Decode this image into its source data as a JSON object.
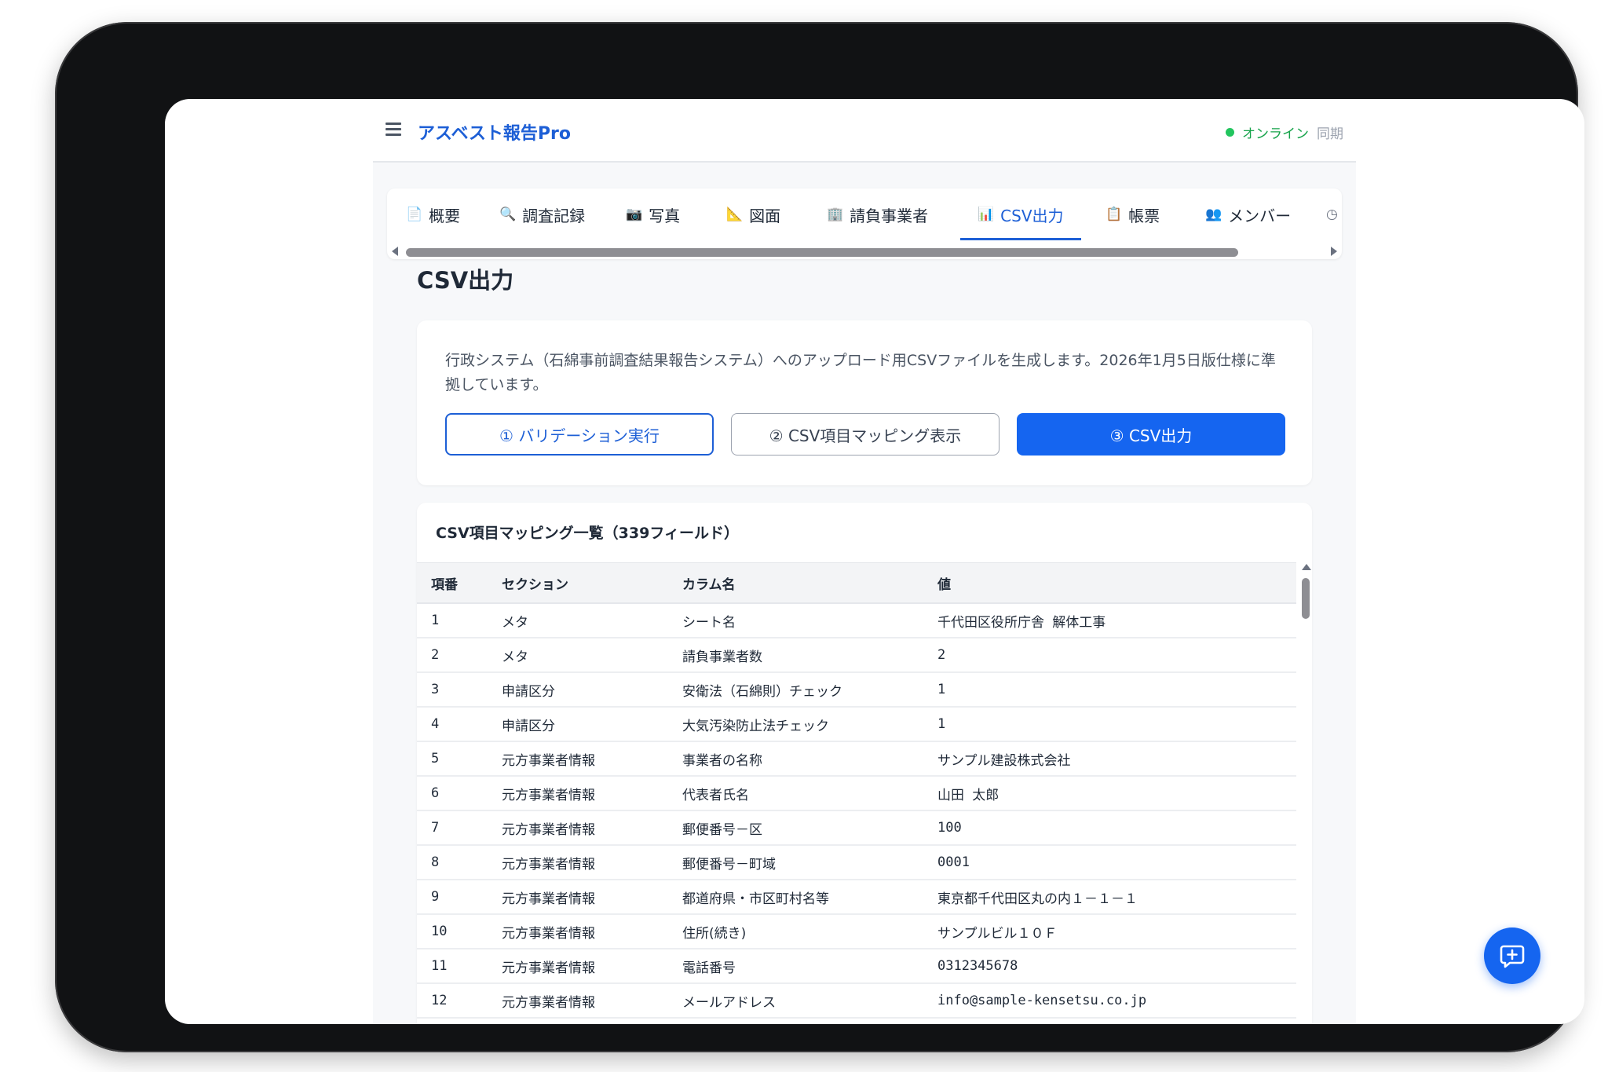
{
  "header": {
    "app_title": "アスベスト報告Pro",
    "status_label": "オンライン",
    "sync_label": "同期"
  },
  "tabs": [
    {
      "icon": "📄",
      "label": "概要"
    },
    {
      "icon": "🔍",
      "label": "調査記録"
    },
    {
      "icon": "📷",
      "label": "写真"
    },
    {
      "icon": "📐",
      "label": "図面"
    },
    {
      "icon": "🏢",
      "label": "請負事業者"
    },
    {
      "icon": "📊",
      "label": "CSV出力"
    },
    {
      "icon": "📋",
      "label": "帳票"
    },
    {
      "icon": "👥",
      "label": "メンバー"
    }
  ],
  "page": {
    "title": "CSV出力"
  },
  "info": {
    "description": "行政システム（石綿事前調査結果報告システム）へのアップロード用CSVファイルを生成します。2026年1月5日版仕様に準拠しています。",
    "validate_button": "① バリデーション実行",
    "mapping_button": "② CSV項目マッピング表示",
    "export_button": "③ CSV出力"
  },
  "mapping_table": {
    "title": "CSV項目マッピング一覧（339フィールド）",
    "columns": [
      "項番",
      "セクション",
      "カラム名",
      "値"
    ],
    "rows": [
      [
        "1",
        "メタ",
        "シート名",
        "千代田区役所庁舎 解体工事"
      ],
      [
        "2",
        "メタ",
        "請負事業者数",
        "2"
      ],
      [
        "3",
        "申請区分",
        "安衛法（石綿則）チェック",
        "1"
      ],
      [
        "4",
        "申請区分",
        "大気汚染防止法チェック",
        "1"
      ],
      [
        "5",
        "元方事業者情報",
        "事業者の名称",
        "サンプル建設株式会社"
      ],
      [
        "6",
        "元方事業者情報",
        "代表者氏名",
        "山田 太郎"
      ],
      [
        "7",
        "元方事業者情報",
        "郵便番号－区",
        "100"
      ],
      [
        "8",
        "元方事業者情報",
        "郵便番号－町域",
        "0001"
      ],
      [
        "9",
        "元方事業者情報",
        "都道府県・市区町村名等",
        "東京都千代田区丸の内１－１－１"
      ],
      [
        "10",
        "元方事業者情報",
        "住所(続き)",
        "サンプルビル１０Ｆ"
      ],
      [
        "11",
        "元方事業者情報",
        "電話番号",
        "0312345678"
      ],
      [
        "12",
        "元方事業者情報",
        "メールアドレス",
        "info@sample-kensetsu.co.jp"
      ]
    ]
  }
}
